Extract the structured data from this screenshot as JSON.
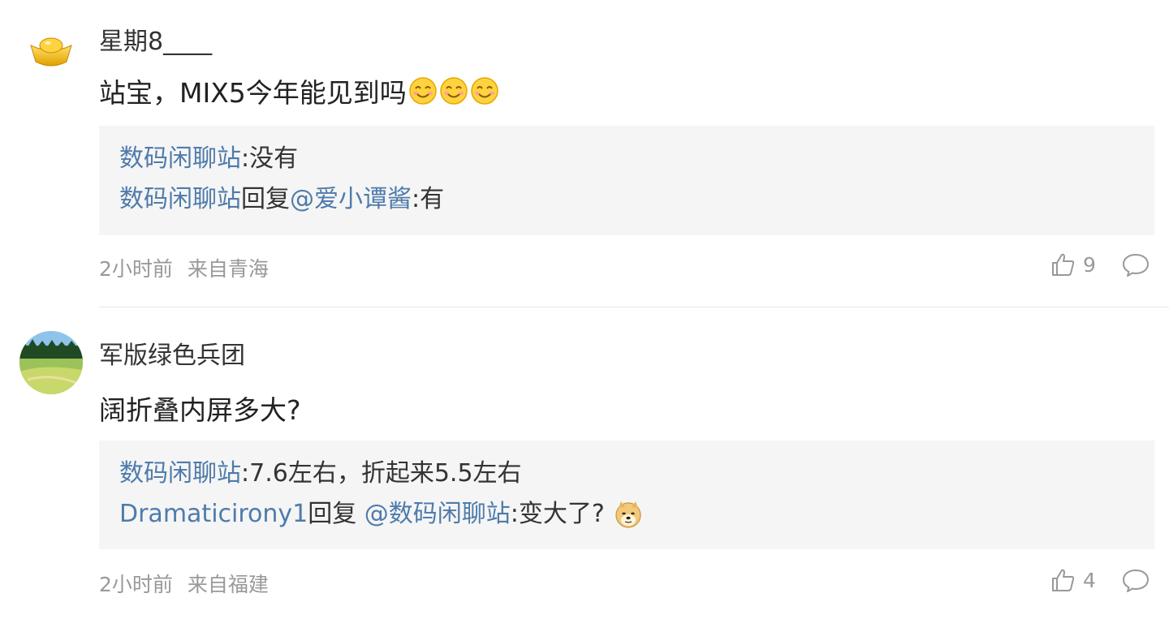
{
  "comments": [
    {
      "username": "星期8____",
      "avatar_icon": "gold-ingot-icon",
      "text": "站宝，MIX5今年能见到吗",
      "emoji_icons": [
        "smiling-face-emoji",
        "smiling-face-emoji",
        "smiling-face-emoji"
      ],
      "replies": [
        {
          "author": "数码闲聊站",
          "sep": ":",
          "text": "没有"
        },
        {
          "author": "数码闲聊站",
          "action": "回复",
          "mention": "@爱小谭酱",
          "sep": ":",
          "text": "有"
        }
      ],
      "time": "2小时前",
      "location": "来自青海",
      "likes": "9"
    },
    {
      "username": "军版绿色兵团",
      "avatar_icon": "landscape-photo-avatar",
      "text": "阔折叠内屏多大?",
      "replies": [
        {
          "author": "数码闲聊站",
          "sep": ":",
          "text": "7.6左右，折起来5.5左右"
        },
        {
          "author": "Dramaticirony1",
          "action": "回复 ",
          "mention": "@数码闲聊站",
          "sep": ":",
          "text": "变大了? ",
          "emoji_icon": "doge-emoji"
        }
      ],
      "time": "2小时前",
      "location": "来自福建",
      "likes": "4"
    }
  ],
  "colors": {
    "link": "#4e7bab",
    "meta": "#999999",
    "reply_bg": "#f5f5f5"
  }
}
